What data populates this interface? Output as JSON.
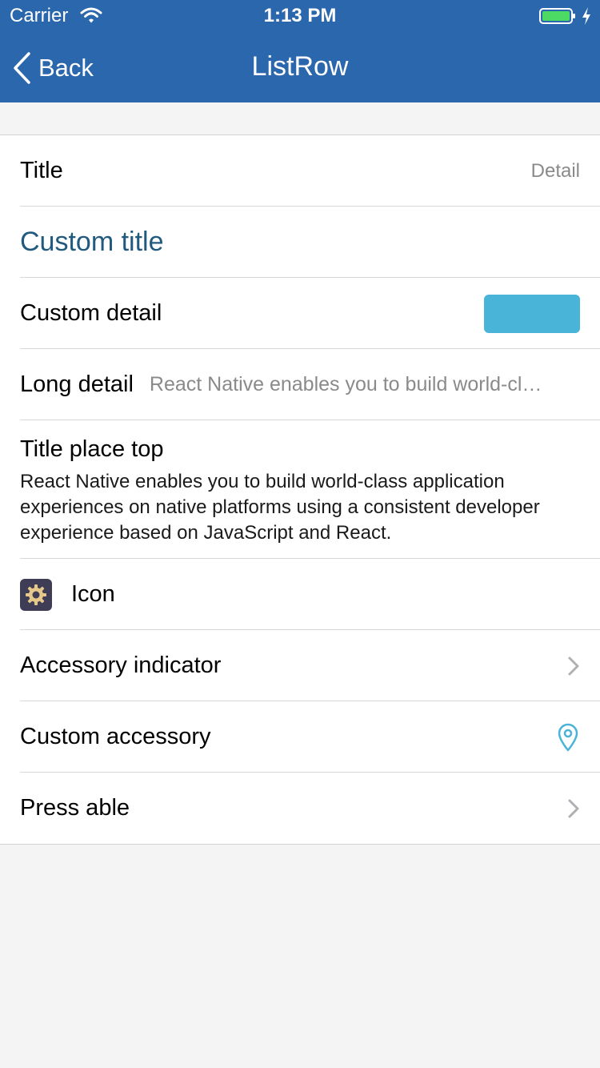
{
  "status_bar": {
    "carrier": "Carrier",
    "time": "1:13 PM",
    "wifi_icon": "wifi-icon",
    "battery_icon": "battery-icon",
    "charging_icon": "charging-bolt-icon",
    "battery_color": "#4cd964"
  },
  "nav": {
    "back_label": "Back",
    "back_icon": "chevron-left-icon",
    "title": "ListRow",
    "bar_color": "#2b67ac"
  },
  "rows": {
    "title_row": {
      "title": "Title",
      "detail": "Detail"
    },
    "custom_title_row": {
      "title": "Custom title",
      "title_color": "#215a7e"
    },
    "custom_detail_row": {
      "title": "Custom detail",
      "swatch_color": "#4ab3d8"
    },
    "long_detail_row": {
      "title": "Long detail",
      "detail": "React Native enables you to build world-cl…"
    },
    "title_top_row": {
      "title": "Title place top",
      "detail": "React Native enables you to build world-class application experiences on native platforms using a consistent developer experience based on JavaScript and React."
    },
    "icon_row": {
      "title": "Icon",
      "icon": "gear-icon",
      "icon_bg": "#3e3d55",
      "icon_color": "#e6c98a"
    },
    "accessory_indicator_row": {
      "title": "Accessory indicator",
      "accessory_icon": "chevron-right-icon"
    },
    "custom_accessory_row": {
      "title": "Custom accessory",
      "accessory_icon": "location-pin-icon",
      "accessory_color": "#4ab3d8"
    },
    "press_able_row": {
      "title": "Press able",
      "accessory_icon": "chevron-right-icon"
    }
  }
}
